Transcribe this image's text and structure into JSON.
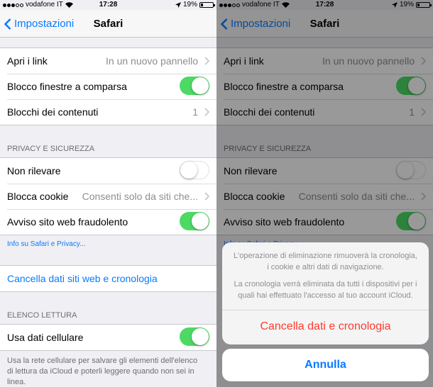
{
  "status": {
    "carrier": "vodafone IT",
    "time": "17:28",
    "battery": "19%",
    "battery_level": 0.19
  },
  "nav": {
    "back_label": "Impostazioni",
    "title": "Safari"
  },
  "general": {
    "open_links_label": "Apri i link",
    "open_links_value": "In un nuovo pannello",
    "popup_label": "Blocco finestre a comparsa",
    "popup_on": true,
    "content_blockers_label": "Blocchi dei contenuti",
    "content_blockers_value": "1"
  },
  "privacy": {
    "header": "PRIVACY E SICUREZZA",
    "dnt_label": "Non rilevare",
    "dnt_on": false,
    "cookies_label": "Blocca cookie",
    "cookies_value": "Consenti solo da siti che...",
    "fraud_label": "Avviso sito web fraudolento",
    "fraud_on": true,
    "info_link": "Info su Safari e Privacy..."
  },
  "clear_label": "Cancella dati siti web e cronologia",
  "reading": {
    "header": "ELENCO LETTURA",
    "cellular_label": "Usa dati cellulare",
    "cellular_on": true,
    "footer_line1": "Usa la rete cellulare per salvare gli elementi dell'elenco",
    "footer_line2": "di lettura da iCloud e poterli leggere quando non sei in",
    "footer_line3": "linea."
  },
  "sheet": {
    "msg1_line1": "L'operazione di eliminazione rimuoverà la cronologia,",
    "msg1_line2": "i cookie e altri dati di navigazione.",
    "msg2_line1": "La cronologia verrà eliminata da tutti i dispositivi per i",
    "msg2_line2": "quali hai effettuato l'accesso al tuo account iCloud.",
    "destructive_label": "Cancella dati e cronologia",
    "cancel_label": "Annulla"
  },
  "colors": {
    "accent": "#0a7aff",
    "switch_on": "#4cd964",
    "destructive": "#ff3b30"
  }
}
